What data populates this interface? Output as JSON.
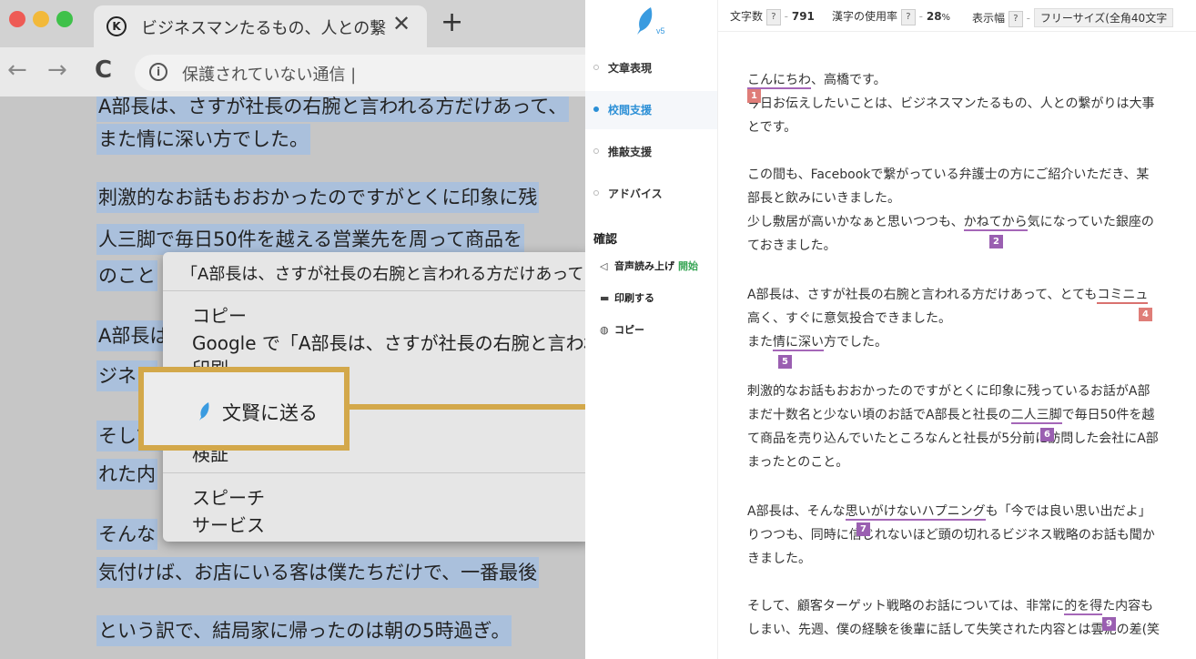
{
  "browser": {
    "tab_title": "ビジネスマンたるもの、人との繋が",
    "tab_close": "✕",
    "new_tab": "+",
    "favicon": "K",
    "back": "←",
    "forward": "→",
    "reload": "C",
    "info_icon": "i",
    "address_text": "保護されていない通信 |"
  },
  "page_lines": [
    "A部長は、さすが社長の右腕と言われる方だけあって、",
    "また情に深い方でした。",
    "刺激的なお話もおおかったのですがとくに印象に残",
    "人三脚で毎日50件を越える営業先を周って商品を",
    "のこと",
    "A部長は",
    "ジネス",
    "そして、",
    "れた内",
    "そんな",
    "気付けば、お店にいる客は僕たちだけで、一番最後",
    "という訳で、結局家に帰ったのは朝の5時過ぎ。"
  ],
  "context_menu": {
    "header": "「A部長は、さすが社長の右腕と言われる方だけあって",
    "items": [
      "コピー",
      "Google で「A部長は、さすが社長の右腕と言われる",
      "印刷...",
      "検証",
      "スピーチ",
      "サービス"
    ]
  },
  "callout": {
    "label": "文賢に送る"
  },
  "app": {
    "logo_version": "v5",
    "nav": [
      "文章表現",
      "校閲支援",
      "推敲支援",
      "アドバイス"
    ],
    "confirm_heading": "確認",
    "sub_items": [
      {
        "label": "音声読み上げ",
        "extra": "開始"
      },
      {
        "label": "印刷する"
      },
      {
        "label": "コピー"
      }
    ],
    "topbar": {
      "char_count_label": "文字数",
      "char_count": "791",
      "kanji_label": "漢字の使用率",
      "kanji_value": "28",
      "kanji_unit": "%",
      "width_label": "表示幅",
      "width_value": "フリーサイズ(全角40文字",
      "help": "?"
    }
  },
  "doc": {
    "lines": [
      {
        "pre": "",
        "u": "こんにちわ",
        "post": "、高橋です。"
      },
      {
        "pre": "今日お伝えしたいことは、ビジネスマンたるもの、人との繋がりは大事",
        "u": "",
        "post": ""
      },
      {
        "pre": "とです。",
        "u": "",
        "post": ""
      },
      {
        "pre": "この間も、Facebookで繋がっている弁護士の方にご紹介いただき、某",
        "u": "",
        "post": ""
      },
      {
        "pre": "部長と飲みにいきました。",
        "u": "",
        "post": ""
      },
      {
        "pre": "少し敷居が高いかなぁと思いつつも、",
        "u": "かねてから",
        "post": "気になっていた銀座の"
      },
      {
        "pre": "ておきました。",
        "u": "",
        "post": ""
      },
      {
        "pre": "A部長は、さすが社長の右腕と言われる方だけあって、とても",
        "u": "コミニュ",
        "post": ""
      },
      {
        "pre": "高く、すぐに意気投合できました。",
        "u": "",
        "post": ""
      },
      {
        "pre": "また",
        "u": "情に深い",
        "post": "方でした。"
      },
      {
        "pre": "刺激的なお話もおおかったのですがとくに印象に残っているお話がA部",
        "u": "",
        "post": ""
      },
      {
        "pre": "まだ十数名と少ない頃のお話でA部長と社長の",
        "u": "二人三脚",
        "post": "で毎日50件を越"
      },
      {
        "pre": "て商品を売り込んでいたところなんと社長が5分前に訪問した会社にA部",
        "u": "",
        "post": ""
      },
      {
        "pre": "まったとのこと。",
        "u": "",
        "post": ""
      },
      {
        "pre": "A部長は、そんな",
        "u": "思いがけないハプニング",
        "post": "も「今では良い思い出だよ」"
      },
      {
        "pre": "りつつも、同時に信じれないほど頭の切れるビジネス戦略のお話も聞か",
        "u": "",
        "post": ""
      },
      {
        "pre": "きました。",
        "u": "",
        "post": ""
      },
      {
        "pre": "そして、顧客ターゲット戦略のお話については、非常に",
        "u": "的を得",
        "post": "た内容も"
      },
      {
        "pre": "しまい、先週、僕の経験を後輩に話して失笑された内容とは雲泥の差(笑",
        "u": "",
        "post": ""
      }
    ],
    "markers": [
      "1",
      "2",
      "4",
      "5",
      "6",
      "7",
      "9"
    ]
  },
  "colors": {
    "accent": "#2b8fd6",
    "callout": "#d3a84a",
    "marker_purple": "#9a5fb1",
    "marker_red": "#df7d78",
    "selection": "#aac0dc"
  }
}
